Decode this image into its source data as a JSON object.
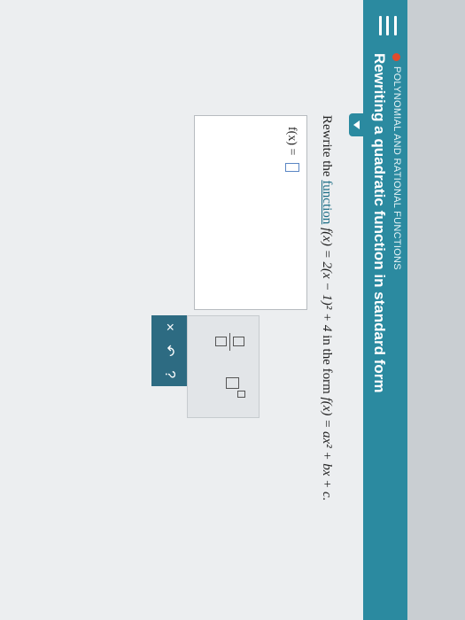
{
  "header": {
    "category": "POLYNOMIAL AND RATIONAL FUNCTIONS",
    "topic": "Rewriting a quadratic function in standard form",
    "menu_icon": "hamburger-icon",
    "status_dot_color": "#e04b2c",
    "bg_color": "#2b8aa0"
  },
  "question": {
    "prefix": "Rewrite the",
    "link_text": "function",
    "given_function": "f(x) = 2(x − 1)² + 4",
    "middle": "in the form",
    "target_form": "f(x) = ax² + bx + c."
  },
  "answer": {
    "label": "f(x) =",
    "value": ""
  },
  "toolbar": {
    "fraction_tool": "fraction-icon",
    "exponent_tool": "exponent-icon",
    "clear_label": "×",
    "undo_label": "↶",
    "help_label": "?",
    "dark_color": "#2d6b82"
  }
}
